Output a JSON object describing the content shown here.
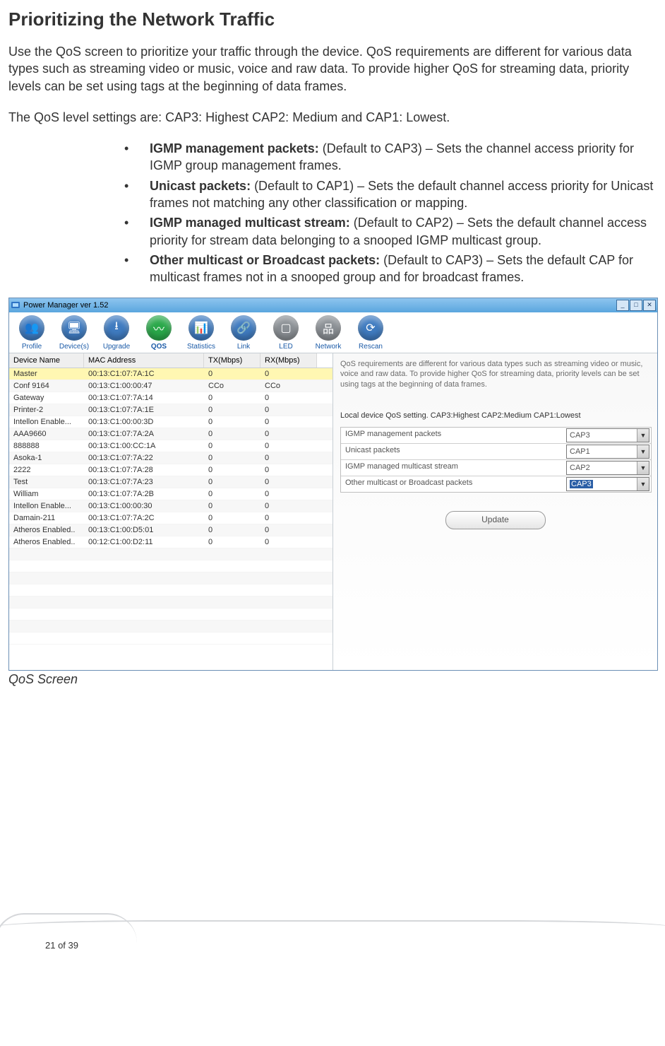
{
  "doc": {
    "title": "Prioritizing the Network Traffic",
    "para1": "Use the QoS screen to prioritize your traffic through the device. QoS requirements are different for various data types such as streaming video or music, voice and raw data. To provide higher QoS for streaming data, priority levels can be set using tags at the beginning of data frames.",
    "para2": "The QoS level settings are: CAP3: Highest CAP2: Medium and CAP1: Lowest.",
    "bullets": [
      {
        "b": "IGMP management packets:",
        "t": " (Default to CAP3) – Sets the channel access priority for IGMP group management frames."
      },
      {
        "b": "Unicast packets:",
        "t": " (Default to CAP1) – Sets the default channel access priority for Unicast frames not matching any other classification or mapping."
      },
      {
        "b": "IGMP managed multicast stream:",
        "t": " (Default to CAP2) – Sets the default channel access priority for stream data belonging to a snooped IGMP multicast group."
      },
      {
        "b": "Other multicast or Broadcast packets:",
        "t": " (Default to CAP3) – Sets the default CAP for multicast frames not in a snooped group and for broadcast frames."
      }
    ],
    "caption": "QoS Screen",
    "page_num": "21 of 39"
  },
  "app": {
    "title": "Power Manager ver 1.52",
    "toolbar": [
      {
        "label": "Profile",
        "glyph": "👥",
        "color": "#3f7bc0"
      },
      {
        "label": "Device(s)",
        "glyph": "🖥",
        "color": "#3f7bc0"
      },
      {
        "label": "Upgrade",
        "glyph": "⭳",
        "color": "#3f7bc0"
      },
      {
        "label": "QOS",
        "glyph": "〰",
        "color": "#2aa84a",
        "active": true
      },
      {
        "label": "Statistics",
        "glyph": "📊",
        "color": "#3f7bc0"
      },
      {
        "label": "Link",
        "glyph": "🔗",
        "color": "#3f7bc0"
      },
      {
        "label": "LED",
        "glyph": "▢",
        "color": "#8a8f94"
      },
      {
        "label": "Network",
        "glyph": "品",
        "color": "#8a8f94"
      },
      {
        "label": "Rescan",
        "glyph": "⟳",
        "color": "#3f7bc0"
      }
    ],
    "columns": [
      "Device Name",
      "MAC Address",
      "TX(Mbps)",
      "RX(Mbps)"
    ],
    "rows": [
      {
        "n": "Master",
        "m": "00:13:C1:07:7A:1C",
        "t": "0",
        "r": "0",
        "sel": true
      },
      {
        "n": "Conf 9164",
        "m": "00:13:C1:00:00:47",
        "t": "CCo",
        "r": "CCo"
      },
      {
        "n": "Gateway",
        "m": "00:13:C1:07:7A:14",
        "t": "0",
        "r": "0"
      },
      {
        "n": "Printer-2",
        "m": "00:13:C1:07:7A:1E",
        "t": "0",
        "r": "0"
      },
      {
        "n": "Intellon Enable...",
        "m": "00:13:C1:00:00:3D",
        "t": "0",
        "r": "0"
      },
      {
        "n": "AAA9660",
        "m": "00:13:C1:07:7A:2A",
        "t": "0",
        "r": "0"
      },
      {
        "n": "888888",
        "m": "00:13:C1:00:CC:1A",
        "t": "0",
        "r": "0"
      },
      {
        "n": "Asoka-1",
        "m": "00:13:C1:07:7A:22",
        "t": "0",
        "r": "0"
      },
      {
        "n": "2222",
        "m": "00:13:C1:07:7A:28",
        "t": "0",
        "r": "0"
      },
      {
        "n": "Test",
        "m": "00:13:C1:07:7A:23",
        "t": "0",
        "r": "0"
      },
      {
        "n": "William",
        "m": "00:13:C1:07:7A:2B",
        "t": "0",
        "r": "0"
      },
      {
        "n": "Intellon Enable...",
        "m": "00:13:C1:00:00:30",
        "t": "0",
        "r": "0"
      },
      {
        "n": "Damain-211",
        "m": "00:13:C1:07:7A:2C",
        "t": "0",
        "r": "0"
      },
      {
        "n": "Atheros Enabled..",
        "m": "00:13:C1:00:D5:01",
        "t": "0",
        "r": "0"
      },
      {
        "n": "Atheros Enabled..",
        "m": "00:12:C1:00:D2:11",
        "t": "0",
        "r": "0"
      }
    ],
    "right_desc": "QoS requirements are different for various data types such as streaming video or music, voice and raw data. To provide higher QoS for streaming data, priority levels can be set using tags at the beginning of data frames.",
    "right_sub": "Local device QoS setting. CAP3:Highest CAP2:Medium CAP1:Lowest",
    "qos_rows": [
      {
        "label": "IGMP management packets",
        "value": "CAP3"
      },
      {
        "label": "Unicast packets",
        "value": "CAP1"
      },
      {
        "label": "IGMP managed multicast stream",
        "value": "CAP2"
      },
      {
        "label": "Other multicast or Broadcast packets",
        "value": "CAP3",
        "highlight": true
      }
    ],
    "update_label": "Update"
  }
}
